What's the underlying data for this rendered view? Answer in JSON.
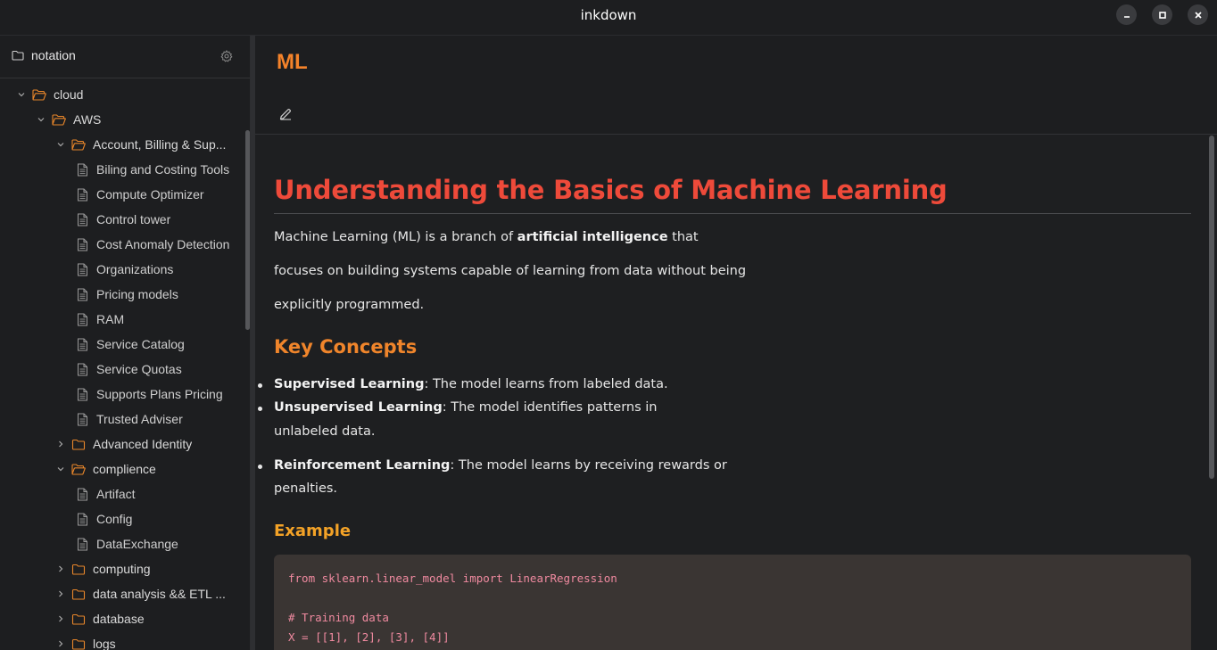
{
  "window": {
    "title": "inkdown"
  },
  "sidebar": {
    "workspace": "notation",
    "tree": [
      {
        "label": "cloud",
        "type": "folder",
        "depth": 0,
        "expanded": true
      },
      {
        "label": "AWS",
        "type": "folder",
        "depth": 1,
        "expanded": true
      },
      {
        "label": "Account, Billing & Sup...",
        "type": "folder",
        "depth": 2,
        "expanded": true
      },
      {
        "label": "Biling and Costing Tools",
        "type": "file",
        "depth": 3
      },
      {
        "label": "Compute Optimizer",
        "type": "file",
        "depth": 3
      },
      {
        "label": "Control tower",
        "type": "file",
        "depth": 3
      },
      {
        "label": "Cost Anomaly Detection",
        "type": "file",
        "depth": 3
      },
      {
        "label": "Organizations",
        "type": "file",
        "depth": 3
      },
      {
        "label": "Pricing models",
        "type": "file",
        "depth": 3
      },
      {
        "label": "RAM",
        "type": "file",
        "depth": 3
      },
      {
        "label": "Service Catalog",
        "type": "file",
        "depth": 3
      },
      {
        "label": "Service Quotas",
        "type": "file",
        "depth": 3
      },
      {
        "label": "Supports Plans Pricing",
        "type": "file",
        "depth": 3
      },
      {
        "label": "Trusted Adviser",
        "type": "file",
        "depth": 3
      },
      {
        "label": "Advanced Identity",
        "type": "folder",
        "depth": 2,
        "expanded": false
      },
      {
        "label": "complience",
        "type": "folder",
        "depth": 2,
        "expanded": true
      },
      {
        "label": "Artifact",
        "type": "file",
        "depth": 3
      },
      {
        "label": "Config",
        "type": "file",
        "depth": 3
      },
      {
        "label": "DataExchange",
        "type": "file",
        "depth": 3
      },
      {
        "label": "computing",
        "type": "folder",
        "depth": 2,
        "expanded": false
      },
      {
        "label": "data analysis && ETL ...",
        "type": "folder",
        "depth": 2,
        "expanded": false
      },
      {
        "label": "database",
        "type": "folder",
        "depth": 2,
        "expanded": false
      },
      {
        "label": "logs",
        "type": "folder",
        "depth": 2,
        "expanded": false
      }
    ]
  },
  "doc": {
    "title": "ML",
    "h1": "Understanding the Basics of Machine Learning",
    "intro": {
      "line1_pre": "Machine Learning (ML) is a branch of ",
      "line1_bold": "artificial intelligence",
      "line1_post": " that",
      "line2": "focuses on building systems capable of learning from data without being",
      "line3": "explicitly programmed."
    },
    "h2": "Key Concepts",
    "concepts": [
      {
        "term": "Supervised Learning",
        "desc": ": The model learns from labeled data.",
        "desc2": ""
      },
      {
        "term": "Unsupervised Learning",
        "desc": ": The model identifies patterns in",
        "desc2": "unlabeled data."
      },
      {
        "term": "Reinforcement Learning",
        "desc": ": The model learns by receiving rewards or",
        "desc2": "penalties."
      }
    ],
    "h3": "Example",
    "code": [
      "from sklearn.linear_model import LinearRegression",
      "",
      "# Training data",
      "X = [[1], [2], [3], [4]]"
    ]
  },
  "colors": {
    "folder": "#e8862a",
    "h1": "#ee4a3a",
    "h2": "#f0852b",
    "h3": "#f3a227",
    "code_text": "#f08aa0"
  }
}
